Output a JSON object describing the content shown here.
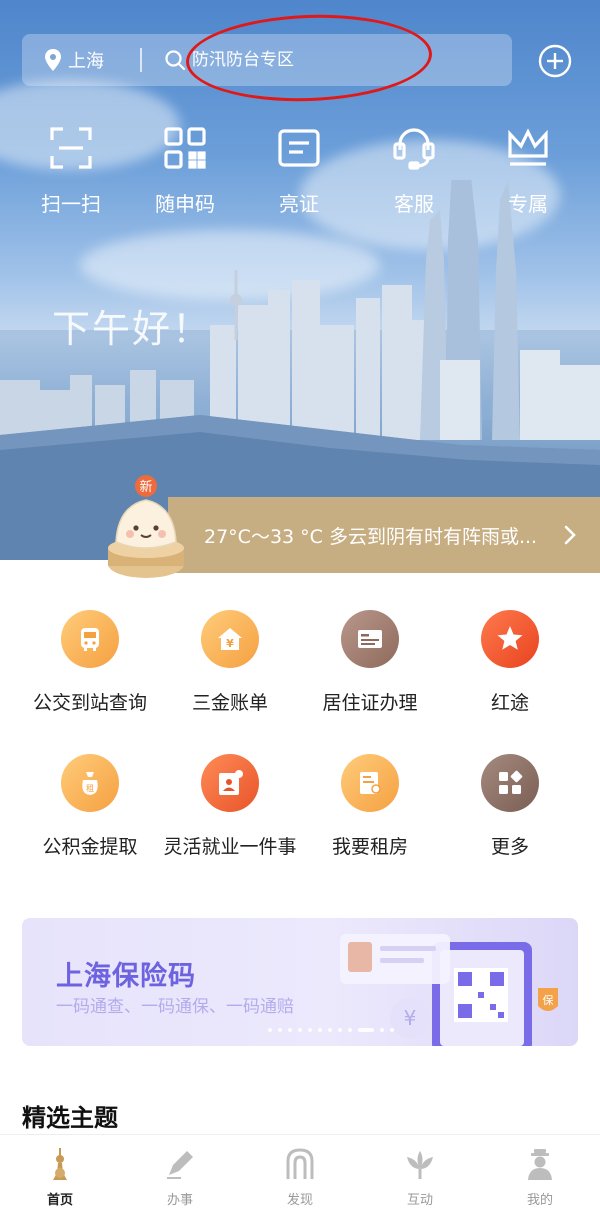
{
  "header": {
    "location": "上海",
    "search_placeholder": "防汛防台专区"
  },
  "quick_actions": [
    {
      "label": "扫一扫",
      "icon": "scan-icon"
    },
    {
      "label": "随申码",
      "icon": "qr-code-icon"
    },
    {
      "label": "亮证",
      "icon": "id-card-icon"
    },
    {
      "label": "客服",
      "icon": "headset-icon"
    },
    {
      "label": "专属",
      "icon": "crown-icon"
    }
  ],
  "greeting": "下午好！",
  "weather": {
    "badge": "新",
    "text": "27°C～33 °C 多云到阴有时有阵雨或..."
  },
  "services": [
    {
      "label": "公交到站查询",
      "icon": "bus-icon",
      "color": "#f7a94a"
    },
    {
      "label": "三金账单",
      "icon": "house-yen-icon",
      "color": "#f7a94a"
    },
    {
      "label": "居住证办理",
      "icon": "residence-card-icon",
      "color": "#9a7464"
    },
    {
      "label": "红途",
      "icon": "red-star-icon",
      "color": "#ef5a2f"
    },
    {
      "label": "公积金提取",
      "icon": "money-bag-icon",
      "color": "#f7a94a"
    },
    {
      "label": "灵活就业一件事",
      "icon": "employment-icon",
      "color": "#ef6a3a"
    },
    {
      "label": "我要租房",
      "icon": "rent-doc-icon",
      "color": "#f7a94a"
    },
    {
      "label": "更多",
      "icon": "more-grid-icon",
      "color": "#8a6e63"
    }
  ],
  "banner": {
    "title": "上海保险码",
    "subtitle": "一码通查、一码通保、一码通赔",
    "badge": "保",
    "dot_count": 12,
    "active_dot": 9
  },
  "section_title": "精选主题",
  "tabs": [
    {
      "label": "首页",
      "icon": "home-tower-icon",
      "active": true
    },
    {
      "label": "办事",
      "icon": "pen-icon",
      "active": false
    },
    {
      "label": "发现",
      "icon": "gate-icon",
      "active": false
    },
    {
      "label": "互动",
      "icon": "flower-icon",
      "active": false
    },
    {
      "label": "我的",
      "icon": "person-icon",
      "active": false
    }
  ]
}
